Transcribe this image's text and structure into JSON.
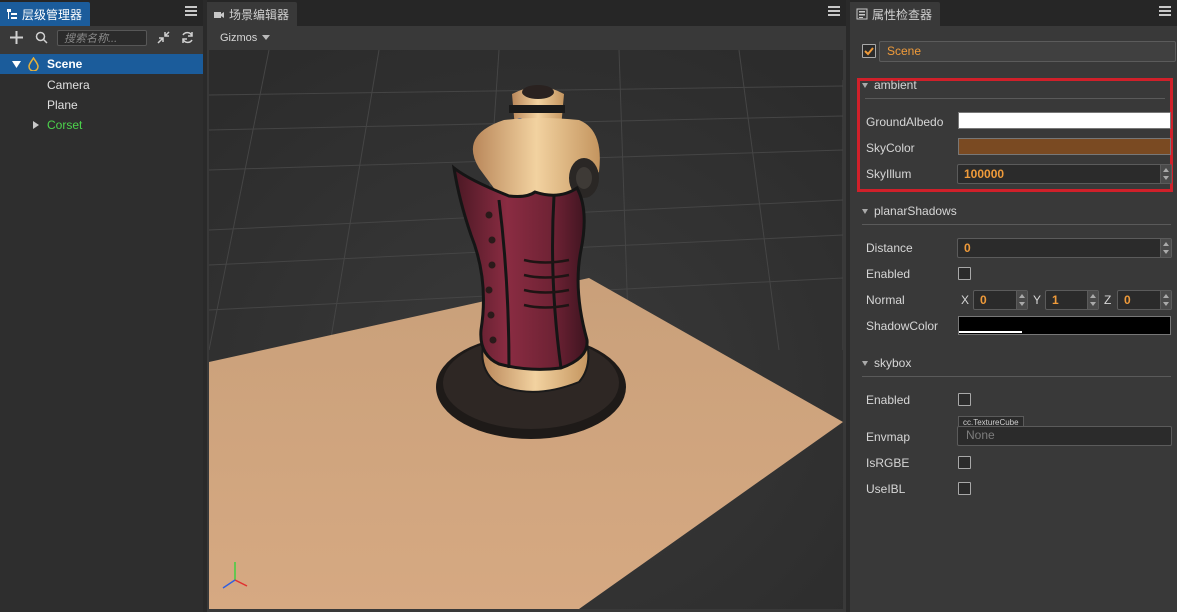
{
  "hierarchy": {
    "tab_label": "层级管理器",
    "search_placeholder": "搜索名称...",
    "tree": [
      {
        "label": "Scene",
        "selected": true
      },
      {
        "label": "Camera"
      },
      {
        "label": "Plane"
      },
      {
        "label": "Corset",
        "color": "#4cd44c"
      }
    ]
  },
  "scene": {
    "tab_label": "场景编辑器",
    "gizmos_label": "Gizmos"
  },
  "inspector": {
    "tab_label": "属性检查器",
    "node_name": "Scene",
    "ambient": {
      "title": "ambient",
      "ground_albedo_label": "GroundAlbedo",
      "ground_albedo_color": "#ffffff",
      "sky_color_label": "SkyColor",
      "sky_color": "#7a4a22",
      "sky_illum_label": "SkyIllum",
      "sky_illum_value": "100000"
    },
    "planar_shadows": {
      "title": "planarShadows",
      "distance_label": "Distance",
      "distance_value": "0",
      "enabled_label": "Enabled",
      "normal_label": "Normal",
      "x_label": "X",
      "x_value": "0",
      "y_label": "Y",
      "y_value": "1",
      "z_label": "Z",
      "z_value": "0",
      "shadow_color_label": "ShadowColor",
      "shadow_color": "#000000"
    },
    "skybox": {
      "title": "skybox",
      "enabled_label": "Enabled",
      "envmap_label": "Envmap",
      "envmap_type": "cc.TextureCube",
      "envmap_value": "None",
      "isrgbe_label": "IsRGBE",
      "useibl_label": "UseIBL"
    },
    "highlight_color": "#d0202a"
  }
}
